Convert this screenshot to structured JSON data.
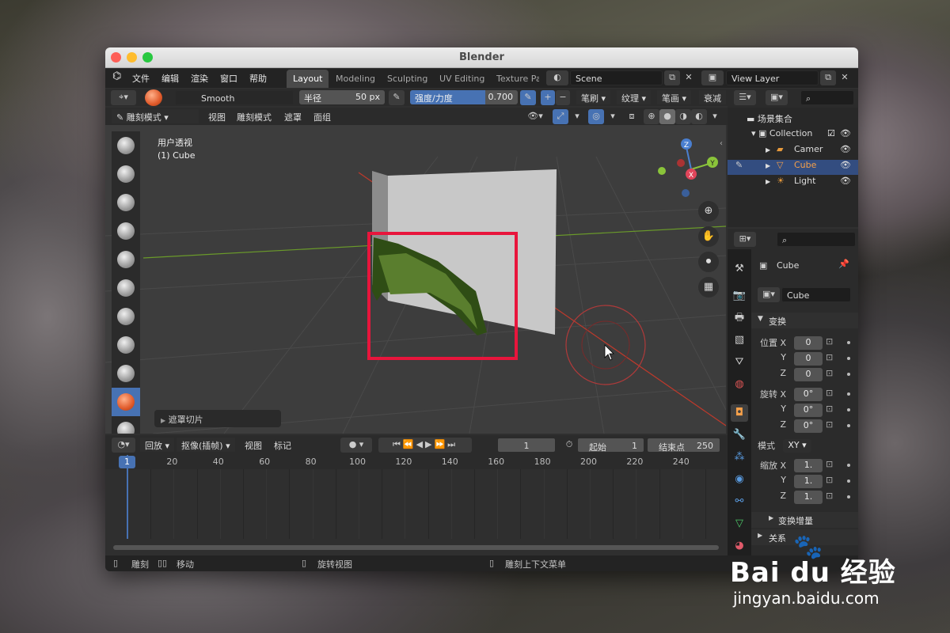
{
  "window": {
    "title": "Blender"
  },
  "menus": [
    "文件",
    "编辑",
    "渲染",
    "窗口",
    "帮助"
  ],
  "workspaces": [
    "Layout",
    "Modeling",
    "Sculpting",
    "UV Editing",
    "Texture Pa"
  ],
  "scene": {
    "name": "Scene",
    "view_layer": "View Layer"
  },
  "tool_header": {
    "brush_name": "Smooth",
    "radius_label": "半径",
    "radius_value": "50 px",
    "strength_label": "强度/力度",
    "strength_value": "0.700",
    "strength_fraction": 0.7,
    "plus": "+",
    "minus": "−",
    "brush_menu": "笔刷",
    "texture_menu": "纹理",
    "stroke_menu": "笔画",
    "falloff_menu": "衰减"
  },
  "viewport_header": {
    "mode": "雕刻模式",
    "view": "视图",
    "sculpt_mode": "雕刻模式",
    "mask": "遮罩",
    "face_sets": "面组"
  },
  "viewport": {
    "perspective_label": "用户透视",
    "object_label": "(1) Cube",
    "gizmo_axes": {
      "z": "Z",
      "y": "Y",
      "x": "X"
    },
    "mask_slice_panel": "遮罩切片"
  },
  "timeline": {
    "playback": "回放",
    "keying": "抠像(插帧)",
    "view": "视图",
    "marker": "标记",
    "current_frame": "1",
    "start_label": "起始",
    "start_value": "1",
    "end_label": "结束点",
    "end_value": "250",
    "ruler": [
      "1",
      "20",
      "40",
      "60",
      "80",
      "100",
      "120",
      "140",
      "160",
      "180",
      "200",
      "220",
      "240"
    ]
  },
  "outliner": {
    "scene_collection": "场景集合",
    "collection": "Collection",
    "items": [
      {
        "label": "Camer",
        "selected": false
      },
      {
        "label": "Cube",
        "selected": true
      },
      {
        "label": "Light",
        "selected": false
      }
    ]
  },
  "properties": {
    "object_name": "Cube",
    "data_name": "Cube",
    "transform_header": "变换",
    "location_label": "位置 X",
    "y_label": "Y",
    "z_label": "Z",
    "location": [
      "0",
      "0",
      "0"
    ],
    "rotation_label": "旋转 X",
    "rotation": [
      "0°",
      "0°",
      "0°"
    ],
    "mode_label": "模式",
    "mode_value": "XY",
    "scale_label": "缩放 X",
    "scale": [
      "1.",
      "1.",
      "1."
    ],
    "delta_transform": "变换增量",
    "relations": "关系"
  },
  "statusbar": {
    "sculpt": "雕刻",
    "move": "移动",
    "rotate_view": "旋转视图",
    "context_menu": "雕刻上下文菜单"
  },
  "watermark": {
    "brand": "Bai du 经验",
    "url": "jingyan.baidu.com"
  },
  "colors": {
    "accent": "#4772b3",
    "highlight_box": "#e8153c",
    "x_axis": "#c0392b",
    "y_axis": "#6a9a2a"
  }
}
